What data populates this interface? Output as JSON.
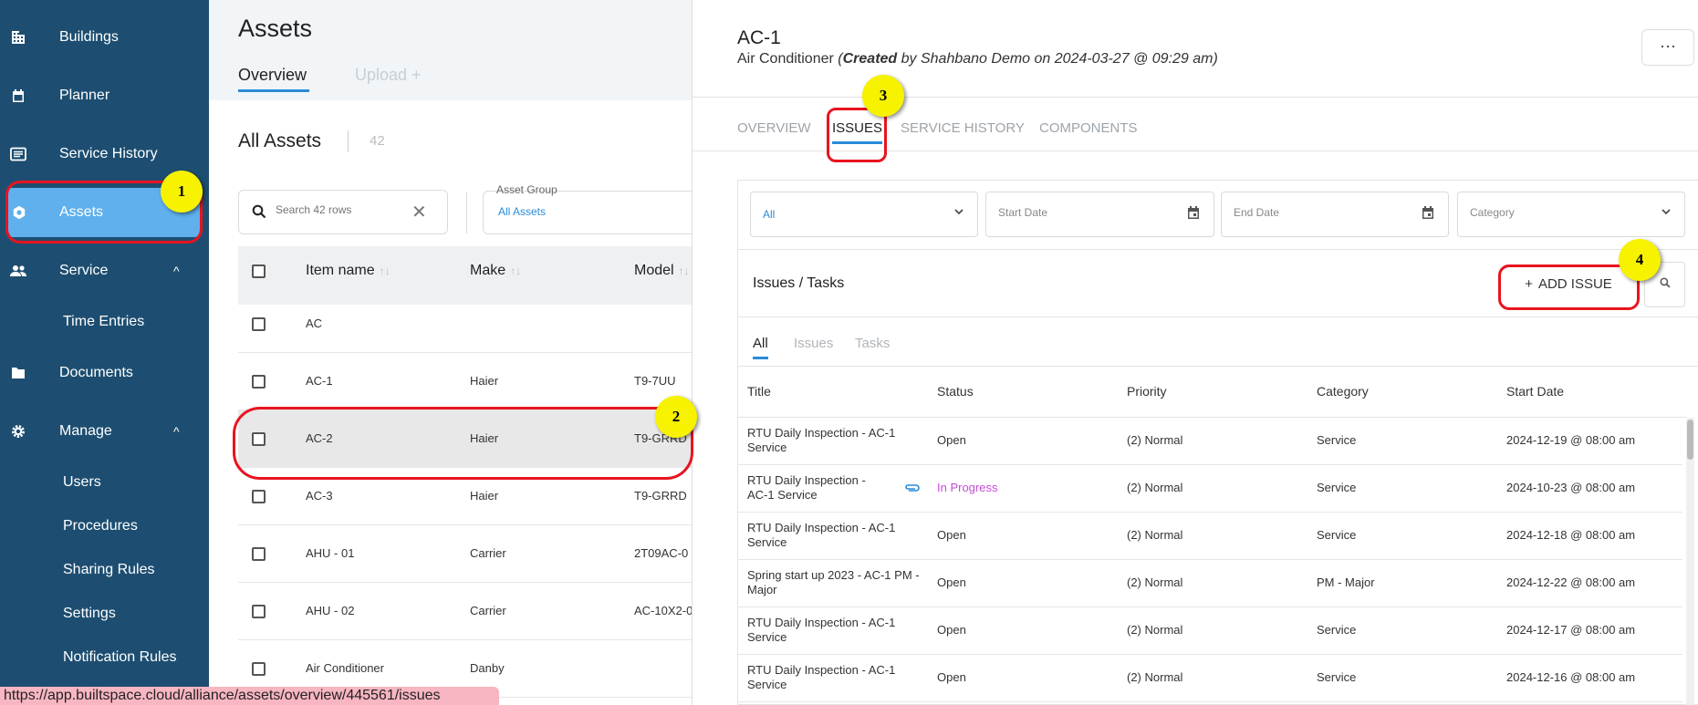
{
  "sidebar": {
    "items": [
      {
        "label": "Buildings",
        "icon": "building-icon"
      },
      {
        "label": "Planner",
        "icon": "calendar-icon"
      },
      {
        "label": "Service History",
        "icon": "list-icon"
      },
      {
        "label": "Assets",
        "icon": "gear-icon"
      },
      {
        "label": "Service",
        "icon": "people-icon",
        "caret": "^"
      },
      {
        "label": "Documents",
        "icon": "folder-icon"
      },
      {
        "label": "Manage",
        "icon": "settings-icon",
        "caret": "^"
      }
    ],
    "service_sub": [
      "Time Entries"
    ],
    "manage_sub": [
      "Users",
      "Procedures",
      "Sharing Rules",
      "Settings",
      "Notification Rules"
    ]
  },
  "assets": {
    "title": "Assets",
    "tab_overview": "Overview",
    "tab_upload": "Upload +",
    "section_title": "All Assets",
    "count": "42",
    "search_placeholder": "Search 42 rows",
    "asset_group_label": "Asset Group",
    "asset_group_value": "All Assets",
    "columns": [
      "Item name",
      "Make",
      "Model"
    ],
    "rows": [
      {
        "name": "AC",
        "make": "",
        "model": ""
      },
      {
        "name": "AC-1",
        "make": "Haier",
        "model": "T9-7UU"
      },
      {
        "name": "AC-2",
        "make": "Haier",
        "model": "T9-GRRD"
      },
      {
        "name": "AC-3",
        "make": "Haier",
        "model": "T9-GRRD"
      },
      {
        "name": "AHU - 01",
        "make": "Carrier",
        "model": "2T09AC-0"
      },
      {
        "name": "AHU - 02",
        "make": "Carrier",
        "model": "AC-10X2-0"
      },
      {
        "name": "Air Conditioner",
        "make": "Danby",
        "model": ""
      }
    ]
  },
  "detail": {
    "name": "AC-1",
    "type": "Air Conditioner",
    "created_prefix": "(",
    "created_word": "Created",
    "created_rest": " by Shahbano Demo on 2024-03-27 @ 09:29 am)",
    "more": "···",
    "tabs": [
      "OVERVIEW",
      "ISSUES",
      "SERVICE HISTORY",
      "COMPONENTS"
    ],
    "filters": {
      "status": "All",
      "start_date": "Start Date",
      "end_date": "End Date",
      "category": "Category"
    },
    "issues_title": "Issues / Tasks",
    "add_issue": "ADD ISSUE",
    "sub_tabs": [
      "All",
      "Issues",
      "Tasks"
    ],
    "columns": [
      "Title",
      "Status",
      "Priority",
      "Category",
      "Start Date"
    ],
    "rows": [
      {
        "title": "RTU Daily Inspection - AC-1 Service",
        "status": "Open",
        "priority": "(2) Normal",
        "category": "Service",
        "start": "2024-12-19 @ 08:00 am"
      },
      {
        "title": "RTU Daily Inspection - AC-1 Service",
        "status": "In Progress",
        "priority": "(2) Normal",
        "category": "Service",
        "start": "2024-10-23 @ 08:00 am"
      },
      {
        "title": "RTU Daily Inspection - AC-1 Service",
        "status": "Open",
        "priority": "(2) Normal",
        "category": "Service",
        "start": "2024-12-18 @ 08:00 am"
      },
      {
        "title": "Spring start up 2023 - AC-1 PM - Major",
        "status": "Open",
        "priority": "(2) Normal",
        "category": "PM - Major",
        "start": "2024-12-22 @ 08:00 am"
      },
      {
        "title": "RTU Daily Inspection - AC-1 Service",
        "status": "Open",
        "priority": "(2) Normal",
        "category": "Service",
        "start": "2024-12-17 @ 08:00 am"
      },
      {
        "title": "RTU Daily Inspection - AC-1 Service",
        "status": "Open",
        "priority": "(2) Normal",
        "category": "Service",
        "start": "2024-12-16 @ 08:00 am"
      }
    ]
  },
  "markers": [
    "1",
    "2",
    "3",
    "4"
  ],
  "status_url": "https://app.builtspace.cloud/alliance/assets/overview/445561/issues",
  "colors": {
    "sidebar": "#1d4e71",
    "active": "#5fb0ec",
    "accent": "#2a8bd8",
    "highlight": "#e8141f",
    "marker": "#f7f200",
    "in_progress": "#c44ad8"
  }
}
